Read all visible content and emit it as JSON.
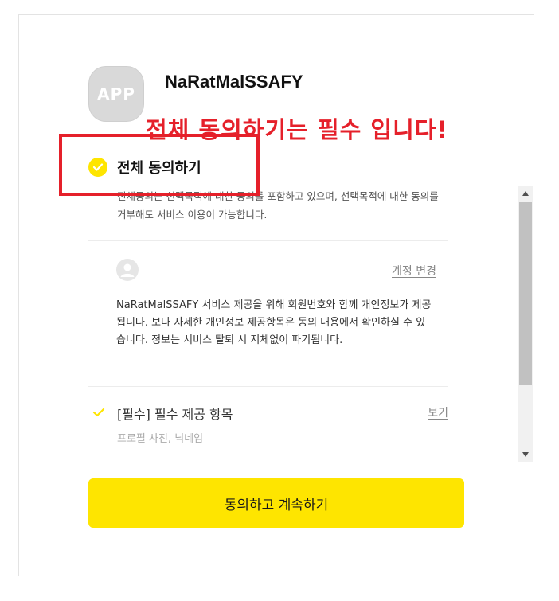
{
  "app": {
    "icon_text": "APP",
    "name": "NaRatMalSSAFY"
  },
  "annotation": {
    "text": "전체 동의하기는 필수 입니다!",
    "color": "#e5202a"
  },
  "agree_all": {
    "label": "전체 동의하기",
    "description": "전체동의는 선택목적에 대한 동의를 포함하고 있으며, 선택목적에 대한 동의를 거부해도 서비스 이용이 가능합니다."
  },
  "account": {
    "change_label": "계정 변경",
    "description": "NaRatMalSSAFY 서비스 제공을 위해 회원번호와 함께 개인정보가 제공됩니다. 보다 자세한 개인정보 제공항목은 동의 내용에서 확인하실 수 있습니다. 정보는 서비스 탈퇴 시 지체없이 파기됩니다."
  },
  "required_item": {
    "label": "[필수] 필수 제공 항목",
    "view_label": "보기",
    "items": "프로필 사진, 닉네임"
  },
  "continue_button": {
    "label": "동의하고 계속하기"
  },
  "colors": {
    "accent": "#fee500",
    "annotation": "#e5202a"
  },
  "icons": [
    "check-circle-icon",
    "user-avatar-icon",
    "check-icon",
    "scroll-up-icon",
    "scroll-down-icon"
  ]
}
